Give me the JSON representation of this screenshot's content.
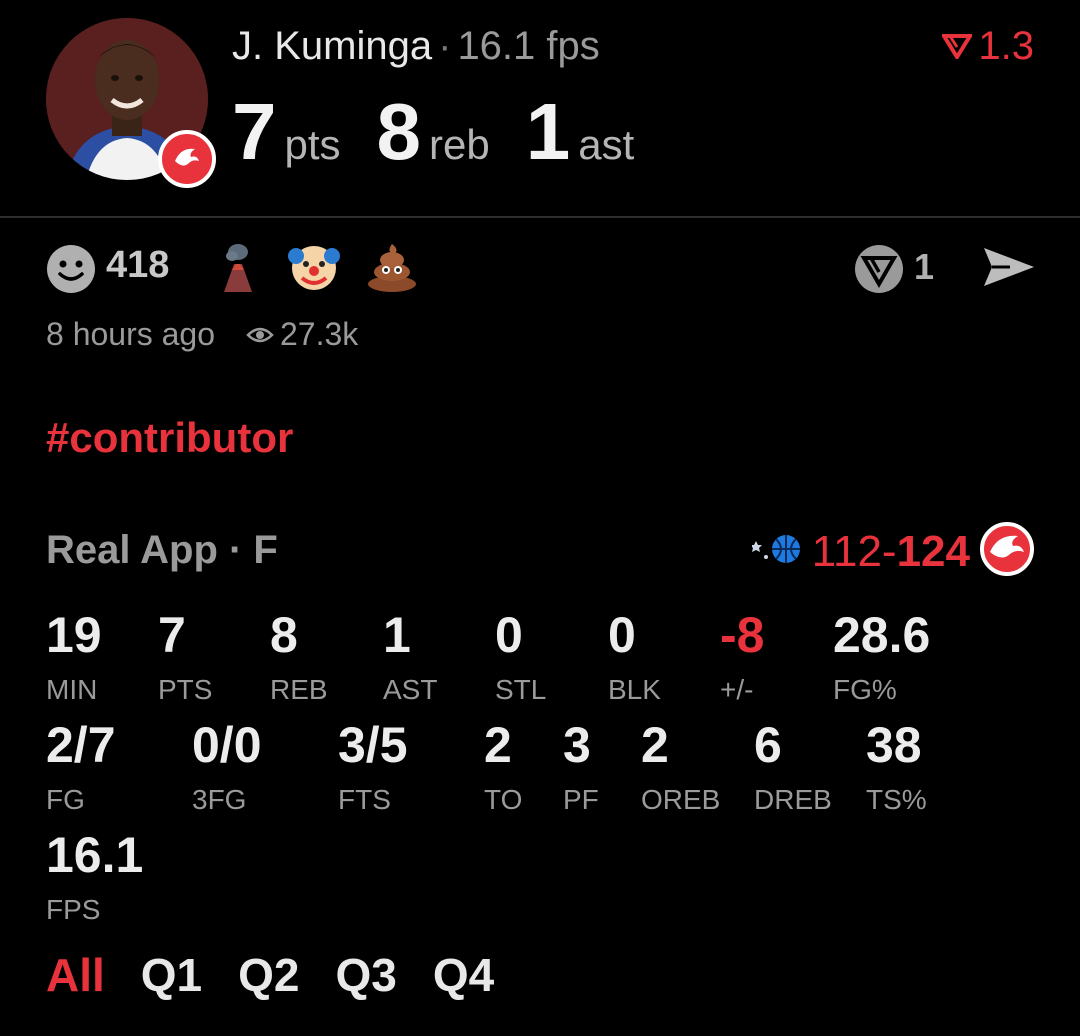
{
  "player": {
    "name": "J. Kuminga",
    "fps_label": "16.1 fps"
  },
  "odds": {
    "value": "1.3",
    "icon": "real-logo-icon"
  },
  "statline": [
    {
      "value": "7",
      "unit": "pts"
    },
    {
      "value": "8",
      "unit": "reb"
    },
    {
      "value": "1",
      "unit": "ast"
    }
  ],
  "reactions": {
    "count": "418",
    "vote_count": "1"
  },
  "post": {
    "time_ago": "8 hours ago",
    "views": "27.3k",
    "hashtag": "#contributor"
  },
  "game": {
    "label": "Real App · F",
    "away_score": "112",
    "separator": "-",
    "home_score": "124"
  },
  "stats_row1": [
    {
      "value": "19",
      "label": "MIN"
    },
    {
      "value": "7",
      "label": "PTS"
    },
    {
      "value": "8",
      "label": "REB"
    },
    {
      "value": "1",
      "label": "AST"
    },
    {
      "value": "0",
      "label": "STL"
    },
    {
      "value": "0",
      "label": "BLK"
    },
    {
      "value": "-8",
      "label": "+/-"
    },
    {
      "value": "28.6",
      "label": "FG%"
    }
  ],
  "stats_row2": [
    {
      "value": "2/7",
      "label": "FG"
    },
    {
      "value": "0/0",
      "label": "3FG"
    },
    {
      "value": "3/5",
      "label": "FTS"
    },
    {
      "value": "2",
      "label": "TO"
    },
    {
      "value": "3",
      "label": "PF"
    },
    {
      "value": "2",
      "label": "OREB"
    },
    {
      "value": "6",
      "label": "DREB"
    },
    {
      "value": "38",
      "label": "TS%"
    }
  ],
  "stats_row3": [
    {
      "value": "16.1",
      "label": "FPS"
    }
  ],
  "tabs": [
    "All",
    "Q1",
    "Q2",
    "Q3",
    "Q4"
  ],
  "colors": {
    "accent": "#e8323c",
    "background": "#000000",
    "muted": "#9a9a9a"
  }
}
